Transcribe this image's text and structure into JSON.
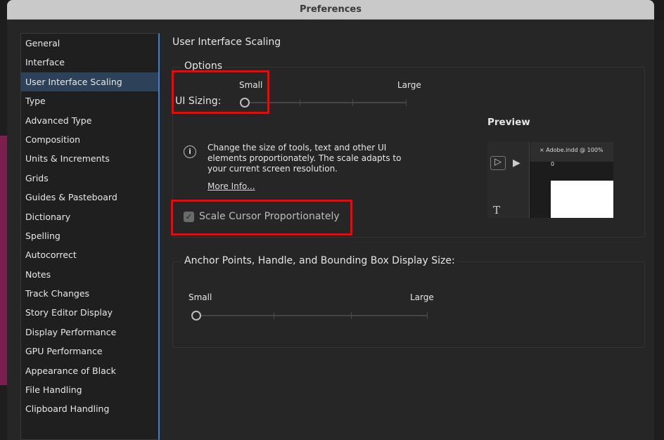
{
  "window": {
    "title": "Preferences"
  },
  "sidebar": {
    "items": [
      {
        "label": "General"
      },
      {
        "label": "Interface"
      },
      {
        "label": "User Interface Scaling",
        "selected": true
      },
      {
        "label": "Type"
      },
      {
        "label": "Advanced Type"
      },
      {
        "label": "Composition"
      },
      {
        "label": "Units & Increments"
      },
      {
        "label": "Grids"
      },
      {
        "label": "Guides & Pasteboard"
      },
      {
        "label": "Dictionary"
      },
      {
        "label": "Spelling"
      },
      {
        "label": "Autocorrect"
      },
      {
        "label": "Notes"
      },
      {
        "label": "Track Changes"
      },
      {
        "label": "Story Editor Display"
      },
      {
        "label": "Display Performance"
      },
      {
        "label": "GPU Performance"
      },
      {
        "label": "Appearance of Black"
      },
      {
        "label": "File Handling"
      },
      {
        "label": "Clipboard Handling"
      }
    ]
  },
  "main": {
    "title": "User Interface Scaling",
    "options": {
      "legend": "Options",
      "ui_sizing_label": "UI Sizing:",
      "min_label": "Small",
      "max_label": "Large",
      "ui_sizing_value": 0,
      "info_text": "Change the size of tools, text and other UI elements proportionately. The scale adapts to your current screen resolution.",
      "more_info": "More Info...",
      "scale_cursor_label": "Scale Cursor Proportionately",
      "scale_cursor_checked": true,
      "preview_label": "Preview",
      "preview_doc_tab": "Adobe.indd @ 100%",
      "ruler_zero": "0"
    },
    "anchor": {
      "legend": "Anchor Points, Handle, and Bounding Box Display Size:",
      "min_label": "Small",
      "max_label": "Large",
      "value": 0
    }
  },
  "colors": {
    "accent": "#3f7ed8",
    "highlight": "#ff0000",
    "selected_bg": "#2d4158"
  }
}
